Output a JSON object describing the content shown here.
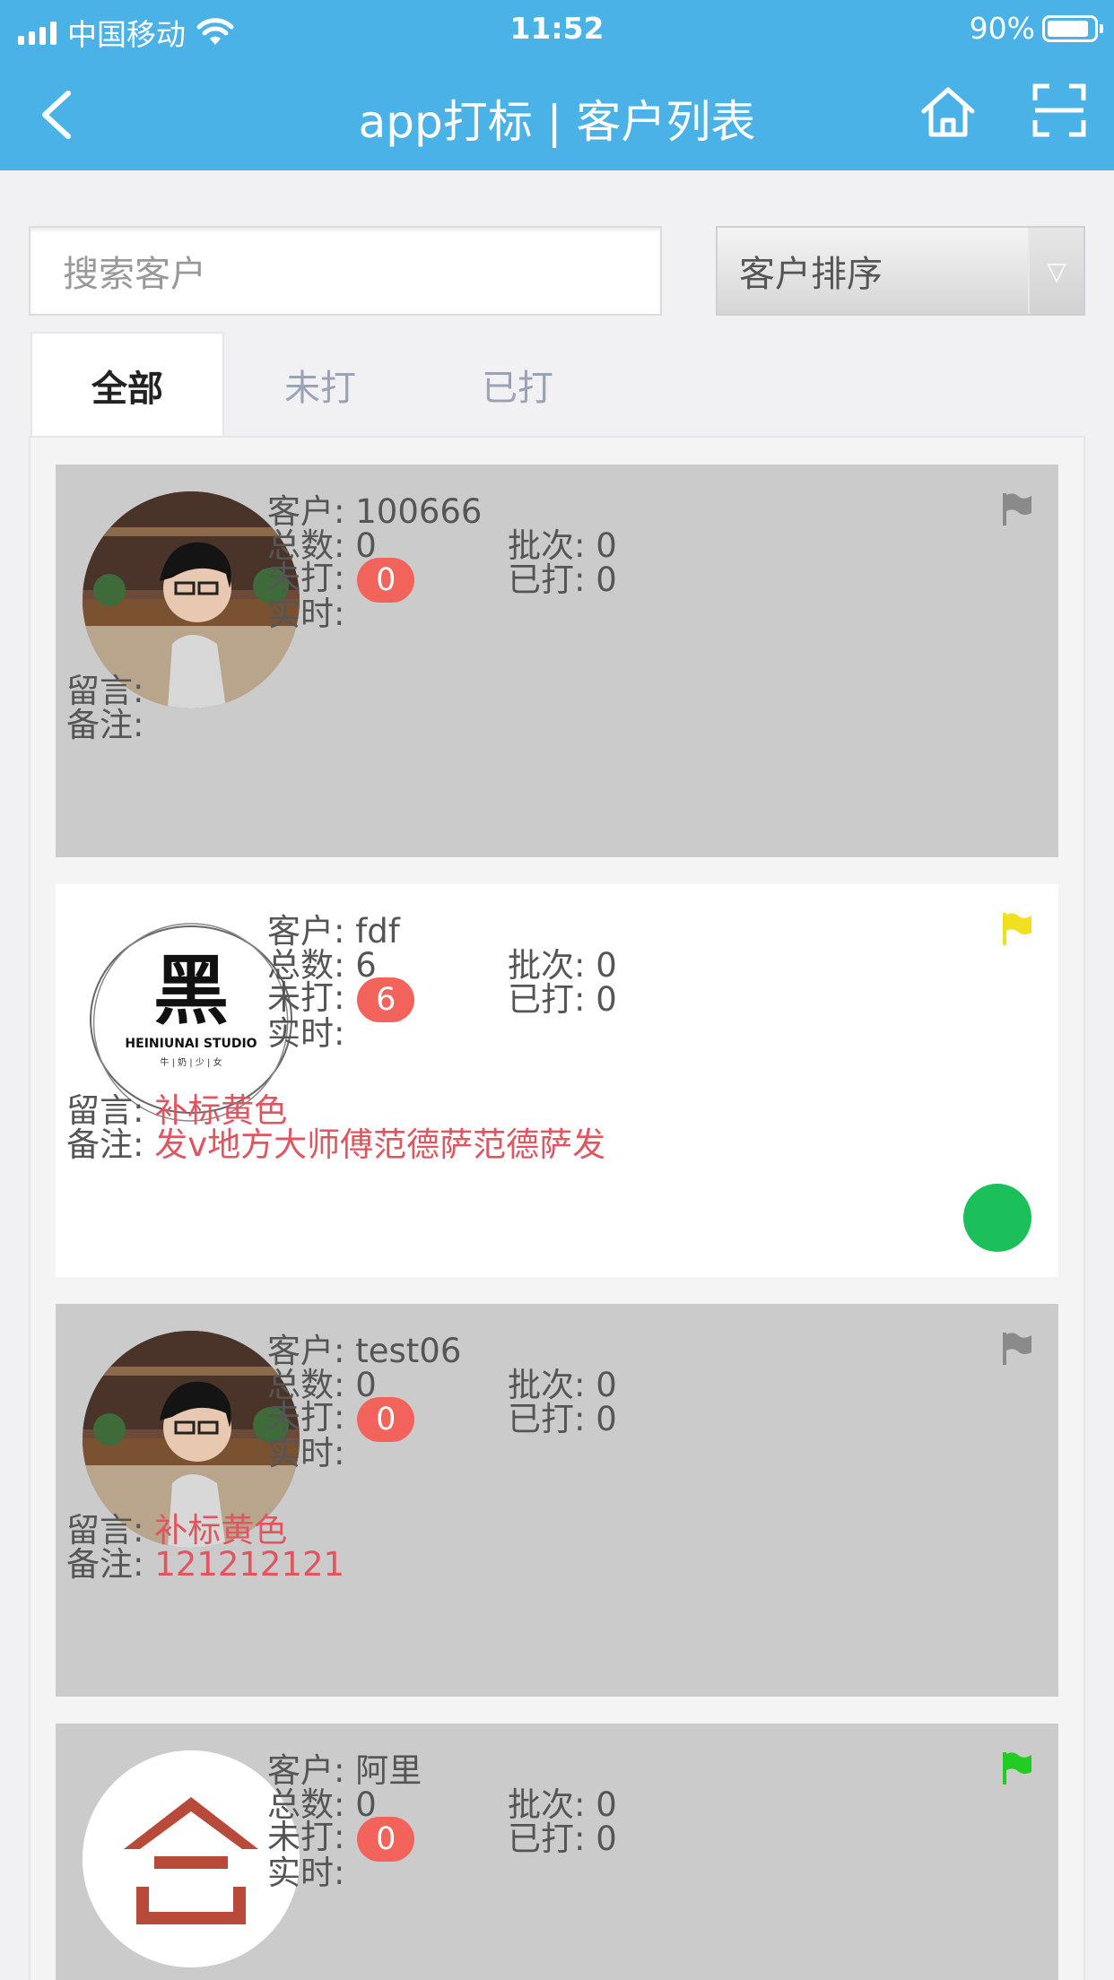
{
  "status_bar": {
    "carrier": "中国移动",
    "time": "11:52",
    "battery": "90%"
  },
  "nav": {
    "title": "app打标 | 客户列表",
    "back_icon": "chevron-left-icon",
    "home_icon": "home-icon",
    "scan_icon": "scan-icon"
  },
  "search": {
    "placeholder": "搜索客户"
  },
  "sort": {
    "label": "客户排序",
    "arrow": "▽"
  },
  "tabs": [
    {
      "label": "全部",
      "active": true
    },
    {
      "label": "未打",
      "active": false
    },
    {
      "label": "已打",
      "active": false
    }
  ],
  "field_labels": {
    "customer": "客户: ",
    "total": "总数: ",
    "batch": "批次: ",
    "unmarked": "未打: ",
    "marked": "已打: ",
    "realtime": "实时:",
    "message": "留言: ",
    "remark": "备注: "
  },
  "customers": [
    {
      "name": "100666",
      "total": "0",
      "batch": "0",
      "unmarked": "0",
      "marked": "0",
      "message": "",
      "remark": "",
      "flag_color": "#8a8a8a",
      "avatar": "photo-avatar",
      "highlighted": false
    },
    {
      "name": "fdf",
      "total": "6",
      "batch": "0",
      "unmarked": "6",
      "marked": "0",
      "message": "补标黄色",
      "remark": "发v地方大师傅范德萨范德萨发",
      "flag_color": "#f0e020",
      "avatar": "logo-avatar",
      "logo_char": "黑",
      "logo_text": "HEINIUNAI STUDIO",
      "logo_sub": "牛 | 奶 | 少 | 女",
      "highlighted": true,
      "status_dot_color": "#1bc05b"
    },
    {
      "name": "test06",
      "total": "0",
      "batch": "0",
      "unmarked": "0",
      "marked": "0",
      "message": "补标黄色",
      "remark": "121212121",
      "flag_color": "#8a8a8a",
      "avatar": "photo-avatar",
      "highlighted": false
    },
    {
      "name": "阿里",
      "total": "0",
      "batch": "0",
      "unmarked": "0",
      "marked": "0",
      "message": "",
      "remark": "",
      "flag_color": "#22cc22",
      "avatar": "house-logo-avatar",
      "highlighted": false
    }
  ]
}
